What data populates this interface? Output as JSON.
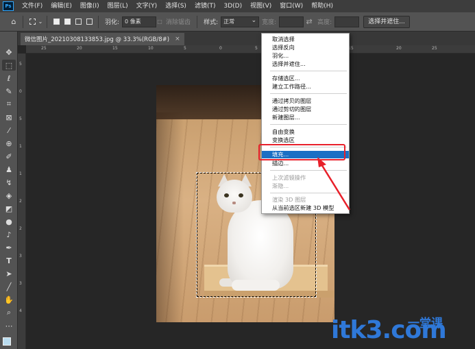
{
  "app": {
    "logo": "Ps"
  },
  "menubar": {
    "items": [
      "文件(F)",
      "编辑(E)",
      "图像(I)",
      "图层(L)",
      "文字(Y)",
      "选择(S)",
      "滤镜(T)",
      "3D(D)",
      "视图(V)",
      "窗口(W)",
      "帮助(H)"
    ]
  },
  "options": {
    "feather_label": "羽化:",
    "feather_value": "0 像素",
    "antialias_label": "消除锯齿",
    "style_label": "样式:",
    "style_value": "正常",
    "width_label": "宽度:",
    "height_label": "高度:",
    "select_mask_button": "选择并遮住..."
  },
  "document": {
    "tab_title": "微信图片_20210308133853.jpg @ 33.3%(RGB/8#)",
    "close": "×"
  },
  "ruler": {
    "top": [
      "25",
      "20",
      "15",
      "10",
      "5",
      "0",
      "5",
      "10",
      "15",
      "20",
      "25"
    ],
    "left": [
      "5",
      "0",
      "5",
      "1",
      "1",
      "2",
      "2",
      "3",
      "3",
      "4"
    ]
  },
  "context_menu": {
    "items": [
      {
        "label": "取消选择",
        "state": "normal"
      },
      {
        "label": "选择反向",
        "state": "normal"
      },
      {
        "label": "羽化...",
        "state": "normal"
      },
      {
        "label": "选择并遮住...",
        "state": "normal"
      },
      {
        "label": "存储选区...",
        "state": "normal"
      },
      {
        "label": "建立工作路径...",
        "state": "normal"
      },
      {
        "label": "通过拷贝的图层",
        "state": "normal"
      },
      {
        "label": "通过剪切的图层",
        "state": "normal"
      },
      {
        "label": "新建图层...",
        "state": "normal"
      },
      {
        "label": "自由变换",
        "state": "normal"
      },
      {
        "label": "变换选区",
        "state": "normal"
      },
      {
        "label": "填充...",
        "state": "highlighted"
      },
      {
        "label": "描边...",
        "state": "normal"
      },
      {
        "label": "上次滤镜操作",
        "state": "disabled"
      },
      {
        "label": "渐隐...",
        "state": "disabled"
      },
      {
        "label": "渲染 3D 图层",
        "state": "disabled"
      },
      {
        "label": "从当前选区新建 3D 模型",
        "state": "normal"
      }
    ]
  },
  "watermark": {
    "text": "itk3.com",
    "cn": "一堂课"
  },
  "colors": {
    "highlight": "#1a6fc4",
    "annotation": "#e8202a",
    "watermark": "#2f78d8",
    "foreground_swatch": "#b9dcef"
  },
  "tools": [
    "move-icon",
    "marquee-icon",
    "lasso-icon",
    "quick-select-icon",
    "crop-icon",
    "frame-icon",
    "eyedropper-icon",
    "healing-icon",
    "brush-icon",
    "stamp-icon",
    "history-brush-icon",
    "eraser-icon",
    "gradient-icon",
    "blur-icon",
    "dodge-icon",
    "pen-icon",
    "type-icon",
    "path-select-icon",
    "line-icon",
    "hand-icon",
    "zoom-icon",
    "more-icon"
  ]
}
